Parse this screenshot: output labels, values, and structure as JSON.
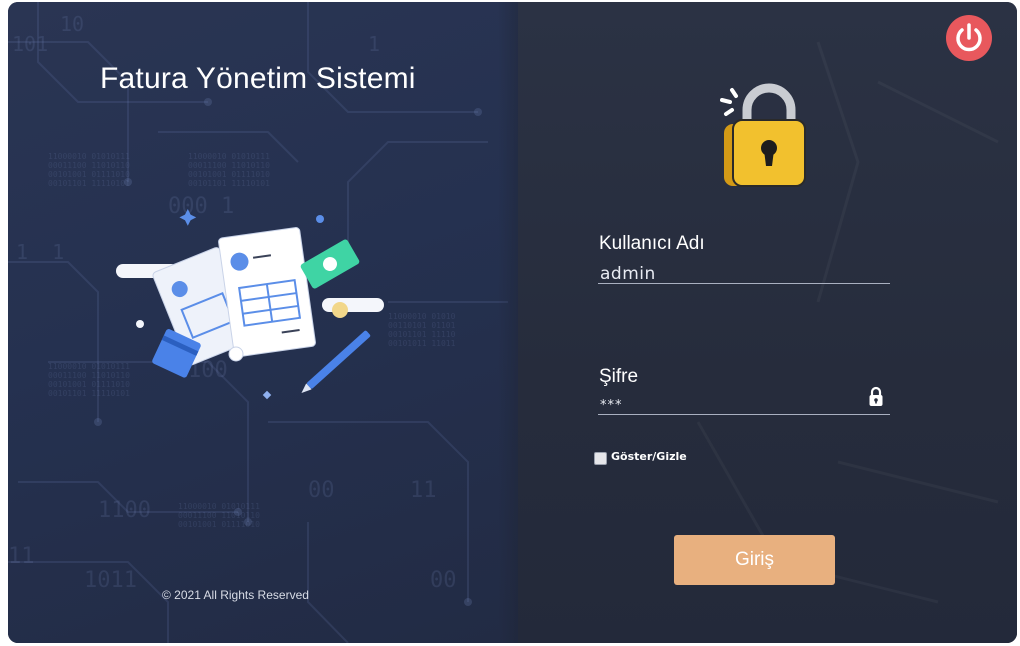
{
  "app": {
    "title": "Fatura Yönetim Sistemi",
    "footer": "© 2021 All Rights Reserved"
  },
  "login": {
    "username_label": "Kullanıcı Adı",
    "username_value": "admin",
    "password_label": "Şifre",
    "password_value": "***",
    "show_hide_label": "Göster/Gizle",
    "submit_label": "Giriş"
  },
  "icons": {
    "power": "power-icon",
    "lock": "padlock-icon",
    "password_lock": "lock-icon",
    "illustration": "invoice-illustration"
  },
  "colors": {
    "power_button": "#e8585d",
    "login_button": "#e8b07f",
    "lock_body": "#f2c12e",
    "background_left": "#253150",
    "background_right": "#262c3c"
  }
}
